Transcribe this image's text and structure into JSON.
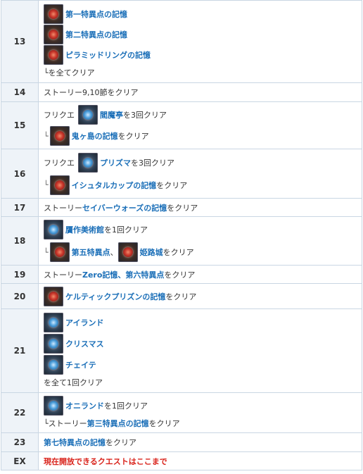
{
  "rows": {
    "r13": {
      "num": "13",
      "a": "第一特異点の記憶",
      "b": "第二特異点の記憶",
      "c": "ピラミッドリングの記憶",
      "d": "└を全てクリア"
    },
    "r14": {
      "num": "14",
      "text": "ストーリー9,10節をクリア"
    },
    "r15": {
      "num": "15",
      "pre": "フリクエ",
      "link1": "閻魔亭",
      "post1": "を3回クリア",
      "link2": "鬼ヶ島の記憶",
      "post2": "をクリア"
    },
    "r16": {
      "num": "16",
      "pre": "フリクエ",
      "link1": "プリズマ",
      "post1": "を3回クリア",
      "link2": "イシュタルカップの記憶",
      "post2": "をクリア"
    },
    "r17": {
      "num": "17",
      "pre": "ストーリー",
      "link": "セイバーウォーズの記憶",
      "post": "をクリア"
    },
    "r18": {
      "num": "18",
      "link1": "贋作美術館",
      "post1": "を1回クリア",
      "link2": "第五特異点",
      "sep": "、",
      "link3": "姫路城",
      "post2": "をクリア"
    },
    "r19": {
      "num": "19",
      "pre": "ストーリー",
      "link": "Zero記憶、第六特異点",
      "post": "をクリア"
    },
    "r20": {
      "num": "20",
      "link": "ケルティックプリズンの記憶",
      "post": "をクリア"
    },
    "r21": {
      "num": "21",
      "a": "アイランド",
      "b": "クリスマス",
      "c": "チェイテ",
      "d": "を全て1回クリア"
    },
    "r22": {
      "num": "22",
      "link1": "オニランド",
      "post1": "を1回クリア",
      "pre2": "└ストーリー",
      "link2": "第三特異点の記憶",
      "post2": "をクリア"
    },
    "r23": {
      "num": "23",
      "link": "第七特異点の記憶",
      "post": "をクリア"
    },
    "rEX": {
      "num": "EX",
      "text": "現在開放できるクエストはここまで"
    }
  },
  "branch_glyph": "└",
  "icons": {
    "memory": "red-gem-quest-icon",
    "event": "blue-gem-quest-icon"
  }
}
